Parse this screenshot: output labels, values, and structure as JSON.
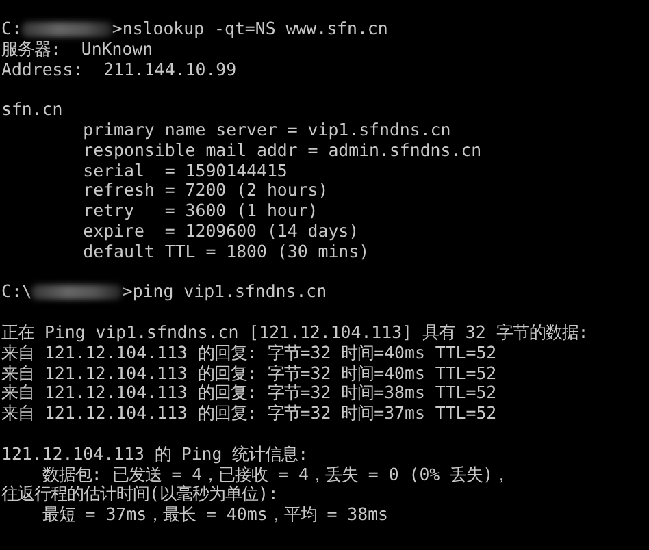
{
  "console": {
    "lines": [
      {
        "kind": "prompt",
        "drive": "C:",
        "command": ">nslookup -qt=NS www.sfn.cn"
      },
      {
        "kind": "text",
        "text": "服务器:  UnKnown"
      },
      {
        "kind": "text",
        "text": "Address:  211.144.10.99"
      },
      {
        "kind": "blank"
      },
      {
        "kind": "text",
        "text": "sfn.cn"
      },
      {
        "kind": "text",
        "text": "        primary name server = vip1.sfndns.cn"
      },
      {
        "kind": "text",
        "text": "        responsible mail addr = admin.sfndns.cn"
      },
      {
        "kind": "text",
        "text": "        serial  = 1590144415"
      },
      {
        "kind": "text",
        "text": "        refresh = 7200 (2 hours)"
      },
      {
        "kind": "text",
        "text": "        retry   = 3600 (1 hour)"
      },
      {
        "kind": "text",
        "text": "        expire  = 1209600 (14 days)"
      },
      {
        "kind": "text",
        "text": "        default TTL = 1800 (30 mins)"
      },
      {
        "kind": "blank"
      },
      {
        "kind": "prompt",
        "drive": "C:\\",
        "command": ">ping vip1.sfndns.cn"
      },
      {
        "kind": "blank"
      },
      {
        "kind": "text",
        "text": "正在 Ping vip1.sfndns.cn [121.12.104.113] 具有 32 字节的数据:"
      },
      {
        "kind": "text",
        "text": "来自 121.12.104.113 的回复: 字节=32 时间=40ms TTL=52"
      },
      {
        "kind": "text",
        "text": "来自 121.12.104.113 的回复: 字节=32 时间=40ms TTL=52"
      },
      {
        "kind": "text",
        "text": "来自 121.12.104.113 的回复: 字节=32 时间=38ms TTL=52"
      },
      {
        "kind": "text",
        "text": "来自 121.12.104.113 的回复: 字节=32 时间=37ms TTL=52"
      },
      {
        "kind": "blank"
      },
      {
        "kind": "text",
        "text": "121.12.104.113 的 Ping 统计信息:"
      },
      {
        "kind": "text",
        "text": "    数据包: 已发送 = 4，已接收 = 4，丢失 = 0 (0% 丢失)，"
      },
      {
        "kind": "text",
        "text": "往返行程的估计时间(以毫秒为单位):"
      },
      {
        "kind": "text",
        "text": "    最短 = 37ms，最长 = 40ms，平均 = 38ms"
      }
    ]
  }
}
